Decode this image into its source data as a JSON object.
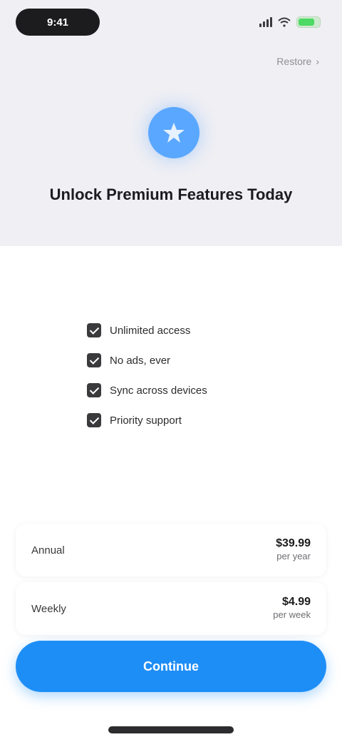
{
  "status_bar": {
    "time": "9:41"
  },
  "header": {
    "restore_label": "Restore",
    "restore_chevron": "›"
  },
  "hero": {
    "logo_icon": "app-logo-icon",
    "headline": "Unlock Premium Features Today"
  },
  "features": [
    {
      "label": "Unlimited access"
    },
    {
      "label": "No ads, ever"
    },
    {
      "label": "Sync across devices"
    },
    {
      "label": "Priority support"
    }
  ],
  "plans": {
    "annual": {
      "name": "Annual",
      "price": "$39.99",
      "sub": "per year"
    },
    "weekly": {
      "name": "Weekly",
      "price": "$4.99",
      "sub": "per week"
    }
  },
  "cta": {
    "label": "Continue"
  },
  "colors": {
    "accent": "#1e8ef7",
    "logo": "#5aa7ff",
    "header_bg": "#efeff4"
  }
}
